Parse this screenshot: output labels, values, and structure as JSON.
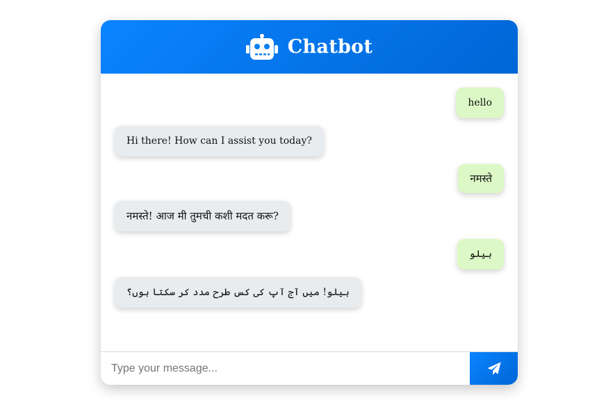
{
  "header": {
    "icon": "robot-icon",
    "title": "Chatbot",
    "gradient": [
      "#0a84ff",
      "#0066d6"
    ]
  },
  "messages": [
    {
      "sender": "user",
      "text": "hello"
    },
    {
      "sender": "bot",
      "text": "Hi there! How can I assist you today?"
    },
    {
      "sender": "user",
      "text": "नमस्ते"
    },
    {
      "sender": "bot",
      "text": "नमस्ते! आज मी तुमची कशी मदत करू?"
    },
    {
      "sender": "user",
      "text": "ہیلو"
    },
    {
      "sender": "bot",
      "text": "ہیلو! میں آج آپ کی کس طرح مدد کر سکتا ہوں؟"
    }
  ],
  "input": {
    "placeholder": "Type your message...",
    "value": ""
  },
  "send": {
    "icon": "paper-plane-icon"
  },
  "colors": {
    "user_bubble": "#dcf8c6",
    "bot_bubble": "#e9ecef"
  }
}
